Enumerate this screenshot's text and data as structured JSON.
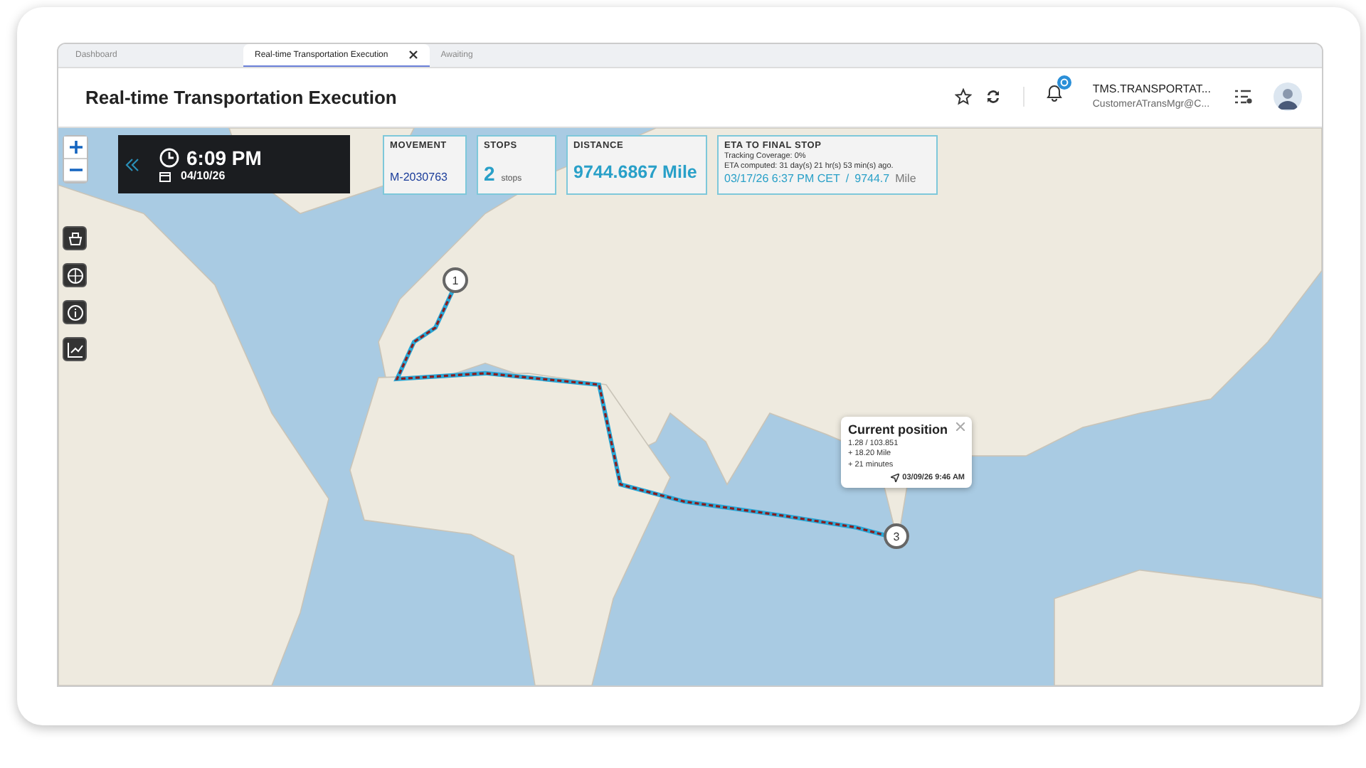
{
  "tabs": [
    {
      "label": "Dashboard",
      "selected": false,
      "closable": false
    },
    {
      "label": "Real-time Transportation Execution",
      "selected": true,
      "closable": true
    },
    {
      "label": "Awaiting",
      "selected": false,
      "closable": false
    }
  ],
  "page_title": "Real-time Transportation Execution",
  "user": {
    "name": "TMS.TRANSPORTAT...",
    "email": "CustomerATransMgr@C..."
  },
  "clock": {
    "time": "6:09 PM",
    "date": "04/10/26"
  },
  "kpis": [
    {
      "kind": "movement",
      "label": "MOVEMENT",
      "value": "M-2030763"
    },
    {
      "kind": "stops",
      "label": "STOPS",
      "value": "2",
      "unit": "stops"
    },
    {
      "kind": "distance",
      "label": "DISTANCE",
      "value": "9744.6867 Mile"
    },
    {
      "kind": "eta",
      "label": "ETA TO FINAL STOP",
      "lines": [
        "Tracking Coverage: 0%",
        "ETA computed: 31 day(s) 21 hr(s) 53 min(s) ago."
      ],
      "value": "03/17/26 6:37 PM CET",
      "separator": "/",
      "distance": "9744.7",
      "unit": "Mile"
    }
  ],
  "stops": [
    {
      "number": "1"
    },
    {
      "number": "3"
    }
  ],
  "current_position": {
    "title": "Current position",
    "coords": "1.28 / 103.851",
    "distance": "+ 18.20 Mile",
    "duration": "+ 21 minutes",
    "timestamp": "03/09/26 9:46 AM"
  }
}
